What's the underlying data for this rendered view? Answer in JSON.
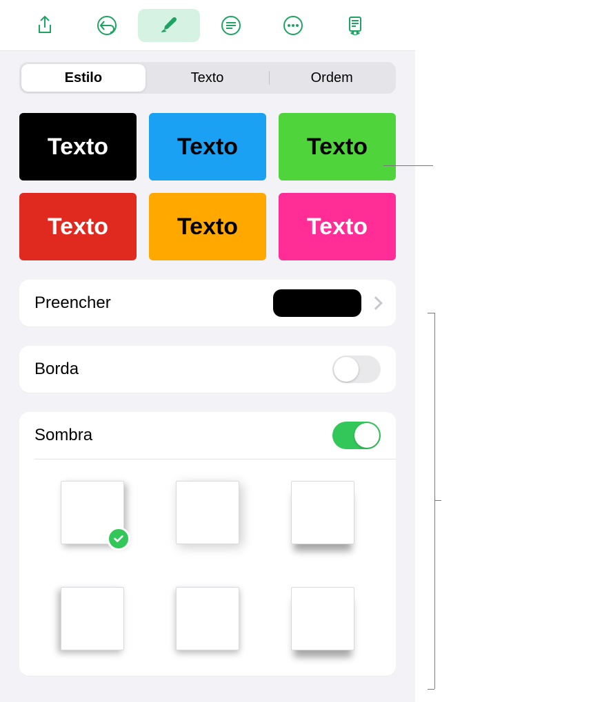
{
  "colors": {
    "accent": "#1EA362",
    "toggleOn": "#33C759"
  },
  "toolbar": {
    "share_icon": "share-icon",
    "undo_icon": "undo-icon",
    "brush_icon": "brush-icon",
    "text_icon": "text-format-icon",
    "more_icon": "more-icon",
    "page_icon": "page-view-icon"
  },
  "segmented": {
    "items": [
      "Estilo",
      "Texto",
      "Ordem"
    ],
    "selected_index": 0
  },
  "presets": [
    {
      "label": "Texto",
      "bg": "#000000",
      "fg": "#FFFFFF"
    },
    {
      "label": "Texto",
      "bg": "#1BA1F3",
      "fg": "#000000"
    },
    {
      "label": "Texto",
      "bg": "#4FD43B",
      "fg": "#000000"
    },
    {
      "label": "Texto",
      "bg": "#E12A1F",
      "fg": "#FFFFFF"
    },
    {
      "label": "Texto",
      "bg": "#FFA900",
      "fg": "#000000"
    },
    {
      "label": "Texto",
      "bg": "#FF2D95",
      "fg": "#FFFFFF"
    }
  ],
  "fill": {
    "label": "Preencher",
    "color": "#000000"
  },
  "border": {
    "label": "Borda",
    "enabled": false
  },
  "shadow": {
    "label": "Sombra",
    "enabled": true,
    "selected_index": 0,
    "options": [
      "sh-1",
      "sh-2",
      "sh-3",
      "sh-4",
      "sh-5",
      "sh-6"
    ]
  }
}
